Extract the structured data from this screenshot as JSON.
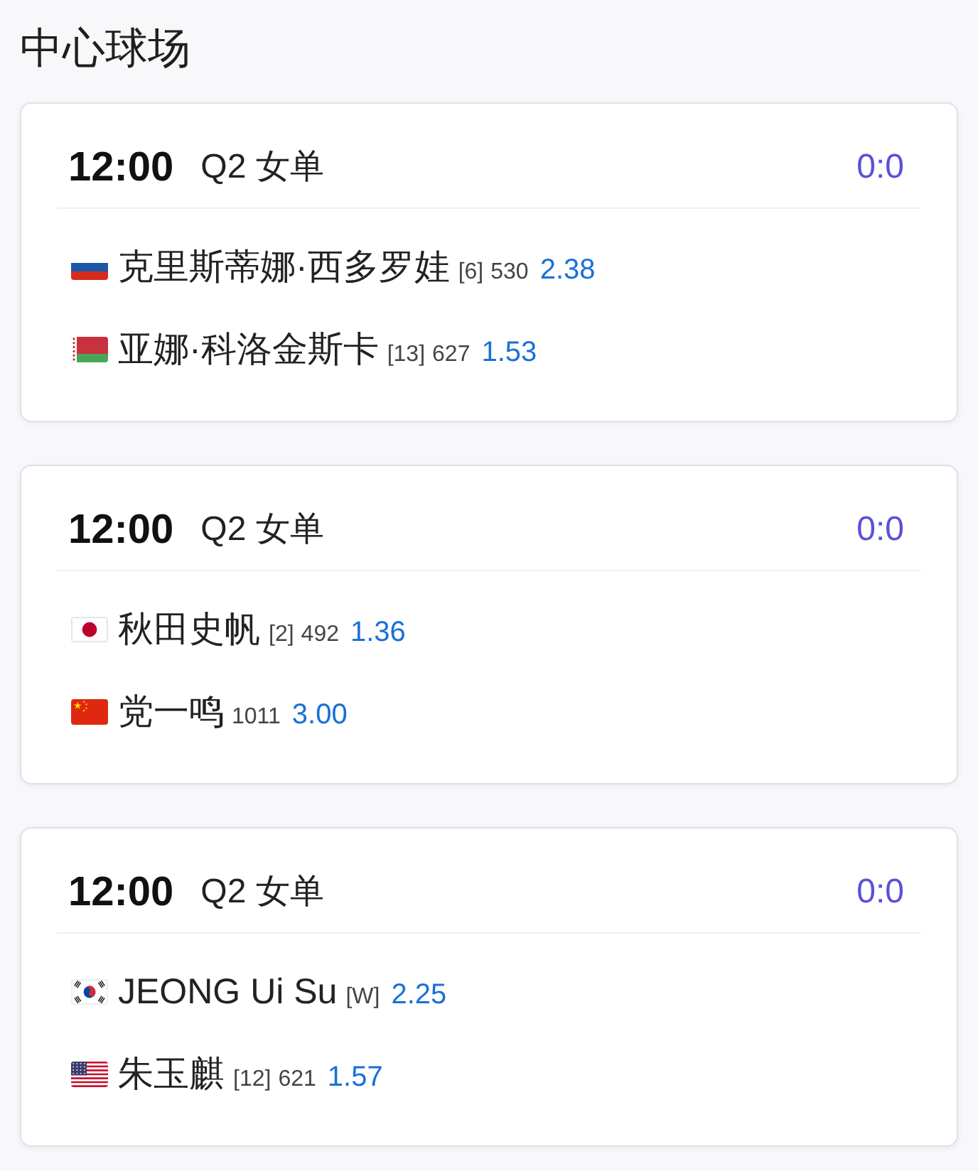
{
  "title": "中心球场",
  "matches": [
    {
      "time": "12:00",
      "round": "Q2 女单",
      "score": "0:0",
      "players": [
        {
          "flag": {
            "kind": "russia"
          },
          "name": "克里斯蒂娜·西多罗娃",
          "seed": "[6]",
          "ranking": "530",
          "odds": "2.38"
        },
        {
          "flag": {
            "kind": "belarus"
          },
          "name": "亚娜·科洛金斯卡",
          "seed": "[13]",
          "ranking": "627",
          "odds": "1.53"
        }
      ]
    },
    {
      "time": "12:00",
      "round": "Q2 女单",
      "score": "0:0",
      "players": [
        {
          "flag": {
            "kind": "japan"
          },
          "name": "秋田史帆",
          "seed": "[2]",
          "ranking": "492",
          "odds": "1.36"
        },
        {
          "flag": {
            "kind": "china"
          },
          "name": "党一鸣",
          "ranking": "1011",
          "odds": "3.00"
        }
      ]
    },
    {
      "time": "12:00",
      "round": "Q2 女单",
      "score": "0:0",
      "players": [
        {
          "flag": {
            "kind": "south_korea"
          },
          "name": "JEONG Ui Su",
          "seed": "[W]",
          "odds": "2.25"
        },
        {
          "flag": {
            "kind": "usa"
          },
          "name": "朱玉麒",
          "seed": "[12]",
          "ranking": "621",
          "odds": "1.57"
        }
      ]
    }
  ]
}
